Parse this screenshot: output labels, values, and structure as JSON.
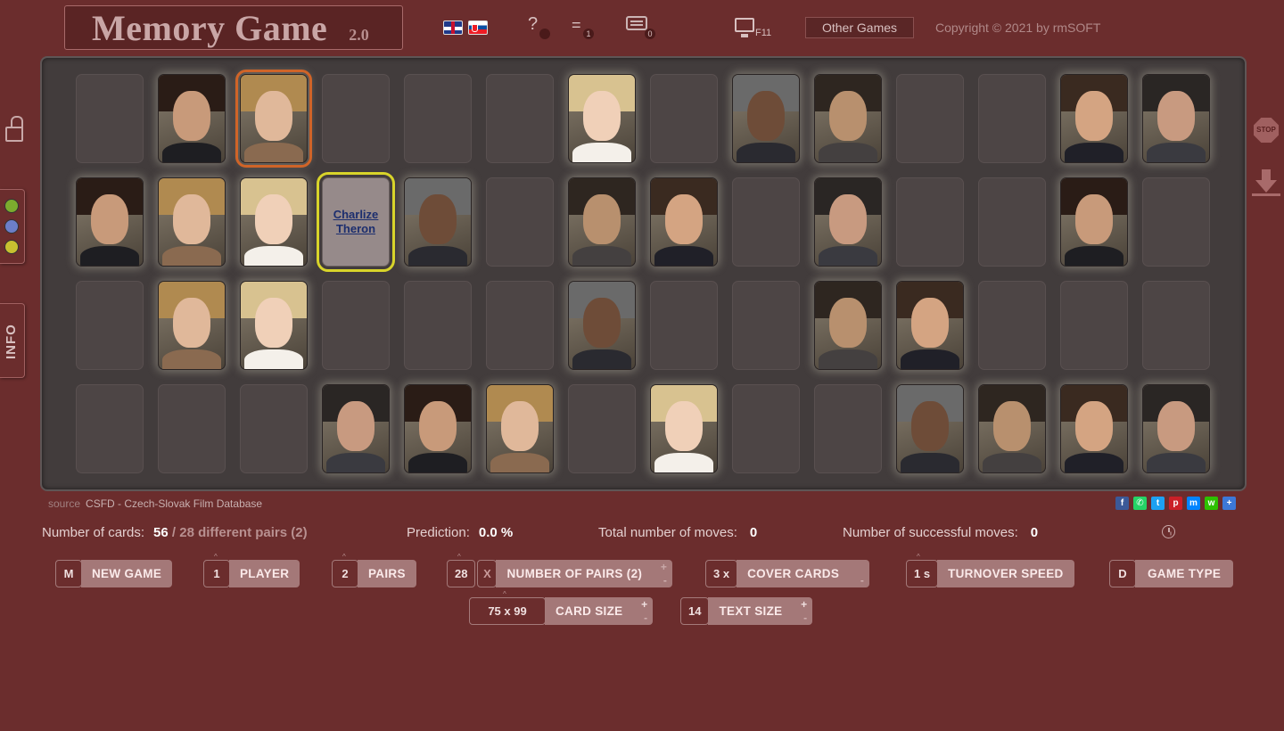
{
  "header": {
    "title": "Memory Game",
    "version": "2.0",
    "help_badge": "",
    "list_badge": "1",
    "keyboard_badge": "0",
    "fullscreen_key": "F11",
    "other_games": "Other Games",
    "copyright": "Copyright © 2021 by rmSOFT"
  },
  "side": {
    "info_label": "INFO",
    "stop_label": "STOP",
    "colors": [
      "#7cab2e",
      "#6c7ec8",
      "#c8c030"
    ]
  },
  "board": {
    "revealed_name_line1": "Charlize",
    "revealed_name_line2": "Theron",
    "rows": [
      [
        "empty",
        "face",
        "face-sel",
        "empty",
        "empty",
        "empty",
        "face",
        "empty",
        "face",
        "face",
        "empty",
        "empty",
        "face",
        "face"
      ],
      [
        "face",
        "face",
        "face",
        "text",
        "face",
        "empty",
        "face",
        "face",
        "empty",
        "face",
        "empty",
        "empty",
        "face",
        "empty"
      ],
      [
        "empty",
        "face",
        "face",
        "empty",
        "empty",
        "empty",
        "face",
        "empty",
        "empty",
        "face",
        "face",
        "empty",
        "empty",
        "empty"
      ],
      [
        "empty",
        "empty",
        "empty",
        "face",
        "face",
        "face",
        "empty",
        "face",
        "empty",
        "empty",
        "face",
        "face",
        "face",
        "face"
      ]
    ],
    "face_palettes": [
      [
        "#2a1c16",
        "#c89a7a",
        "#1e1e22"
      ],
      [
        "#b08a50",
        "#e0b89a",
        "#8a6a50"
      ],
      [
        "#d8c290",
        "#f0d0b8",
        "#f4f0ea"
      ],
      [
        "#6a6a6a",
        "#6e4c38",
        "#2a2a30"
      ],
      [
        "#2e2620",
        "#b8906e",
        "#444040"
      ],
      [
        "#3a2a20",
        "#d4a482",
        "#202028"
      ],
      [
        "#2a2624",
        "#c89a80",
        "#3a3a40"
      ]
    ]
  },
  "source": {
    "label": "source",
    "value": "CSFD - Czech-Slovak Film Database"
  },
  "share": [
    {
      "name": "facebook-icon",
      "glyph": "f",
      "color": "#3b5998"
    },
    {
      "name": "whatsapp-icon",
      "glyph": "✆",
      "color": "#25d366"
    },
    {
      "name": "twitter-icon",
      "glyph": "t",
      "color": "#1da1f2"
    },
    {
      "name": "pinterest-icon",
      "glyph": "p",
      "color": "#cb2027"
    },
    {
      "name": "messenger-icon",
      "glyph": "m",
      "color": "#0084ff"
    },
    {
      "name": "wechat-icon",
      "glyph": "w",
      "color": "#2dc100"
    },
    {
      "name": "more-share-icon",
      "glyph": "+",
      "color": "#3c78d8"
    }
  ],
  "stats": {
    "cards_label": "Number of cards:",
    "cards_value": "56",
    "pairs_value": "/ 28  different pairs (2)",
    "prediction_label": "Prediction:",
    "prediction_value": "0.0 %",
    "total_moves_label": "Total number of moves:",
    "total_moves_value": "0",
    "success_moves_label": "Number of successful moves:",
    "success_moves_value": "0"
  },
  "controls": {
    "new_game": {
      "key": "M",
      "label": "NEW GAME"
    },
    "player": {
      "key": "1",
      "label": "PLAYER"
    },
    "pairs": {
      "key": "2",
      "label": "PAIRS"
    },
    "num_pairs": {
      "key": "28",
      "key2": "X",
      "label": "NUMBER OF PAIRS (2)"
    },
    "cover": {
      "key": "3 x",
      "label": "COVER CARDS"
    },
    "speed": {
      "key": "1 s",
      "label": "TURNOVER SPEED"
    },
    "game_type": {
      "key": "D",
      "label": "GAME TYPE"
    },
    "card_size": {
      "key": "75 x 99",
      "label": "CARD SIZE"
    },
    "text_size": {
      "key": "14",
      "label": "TEXT SIZE"
    },
    "plus": "+",
    "minus": "-"
  }
}
